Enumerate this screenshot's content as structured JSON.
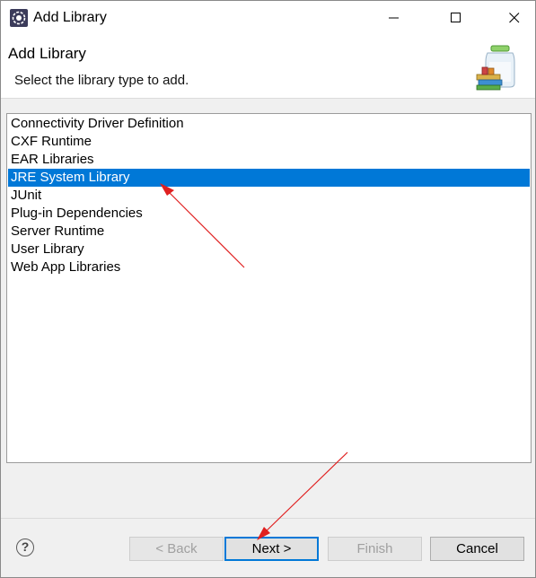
{
  "window": {
    "title": "Add Library",
    "controls": {
      "minimize_icon": "minimize-icon",
      "maximize_icon": "maximize-icon",
      "close_icon": "close-icon"
    }
  },
  "banner": {
    "title": "Add Library",
    "description": "Select the library type to add.",
    "icon": "library-jar-icon"
  },
  "library_types": {
    "items": [
      {
        "label": "Connectivity Driver Definition",
        "selected": false
      },
      {
        "label": "CXF Runtime",
        "selected": false
      },
      {
        "label": "EAR Libraries",
        "selected": false
      },
      {
        "label": "JRE System Library",
        "selected": true
      },
      {
        "label": "JUnit",
        "selected": false
      },
      {
        "label": "Plug-in Dependencies",
        "selected": false
      },
      {
        "label": "Server Runtime",
        "selected": false
      },
      {
        "label": "User Library",
        "selected": false
      },
      {
        "label": "Web App Libraries",
        "selected": false
      }
    ]
  },
  "footer": {
    "help_label": "?",
    "back_label": "< Back",
    "next_label": "Next >",
    "finish_label": "Finish",
    "cancel_label": "Cancel"
  },
  "colors": {
    "selection": "#0078d7",
    "annotation_arrow": "#e02020",
    "default_button_border": "#0078d7"
  }
}
